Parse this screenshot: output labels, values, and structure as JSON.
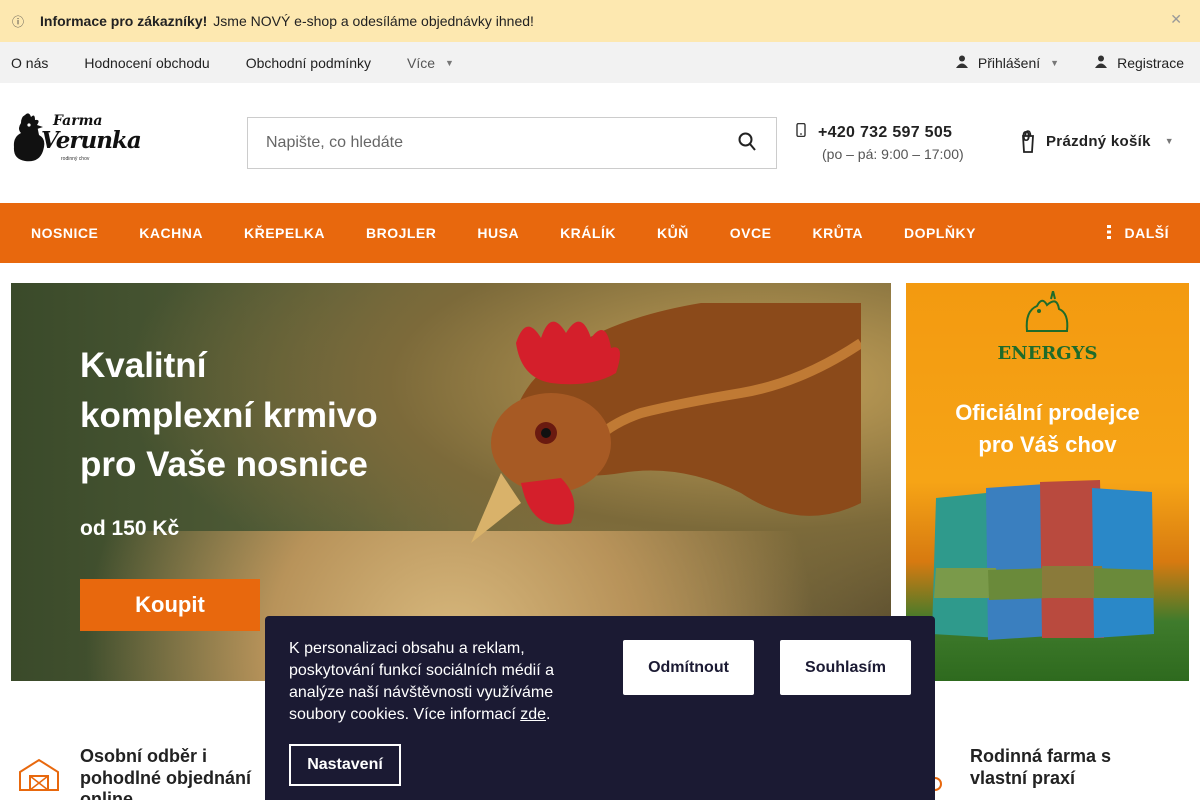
{
  "infobar": {
    "title": "Informace pro zákazníky!",
    "message": "Jsme NOVÝ e-shop a odesíláme objednávky ihned!"
  },
  "topnav": {
    "links": [
      "O nás",
      "Hodnocení obchodu",
      "Obchodní podmínky"
    ],
    "more": "Více",
    "login": "Přihlášení",
    "register": "Registrace"
  },
  "logo": {
    "line1": "Farma",
    "line2": "Verunka",
    "line3": "rodinný chov"
  },
  "search": {
    "placeholder": "Napište, co hledáte"
  },
  "contact": {
    "phone": "+420 732 597 505",
    "hours": "(po – pá: 9:00 – 17:00)"
  },
  "cart": {
    "label": "Prázdný košík",
    "count": "0"
  },
  "categories": [
    "NOSNICE",
    "KACHNA",
    "KŘEPELKA",
    "BROJLER",
    "HUSA",
    "KRÁLÍK",
    "KŮŇ",
    "OVCE",
    "KRŮTA",
    "DOPLŇKY"
  ],
  "categories_more": "DALŠÍ",
  "hero": {
    "line1": "Kvalitní",
    "line2": "komplexní krmivo",
    "line3": "pro Vaše nosnice",
    "price": "od 150 Kč",
    "button": "Koupit"
  },
  "side_banner": {
    "brand": "ENERGYS",
    "tagline1": "Oficiální prodejce",
    "tagline2": "pro Váš chov"
  },
  "benefits": [
    {
      "title": "Osobní odběr i pohodlné objednání online"
    },
    {
      "title": "Rodinná farma s vlastní praxí"
    }
  ],
  "cookie": {
    "text": "K personalizaci obsahu a reklam, poskytování funkcí sociálních médií a analýze naší návštěvnosti využíváme soubory cookies. Více informací",
    "link": "zde",
    "deny": "Odmítnout",
    "accept": "Souhlasím",
    "settings": "Nastavení"
  },
  "colors": {
    "accent": "#e8680d",
    "infobar": "#fde8b0",
    "topnav": "#f2f2f2",
    "cookie_bg": "#1b1a33"
  }
}
